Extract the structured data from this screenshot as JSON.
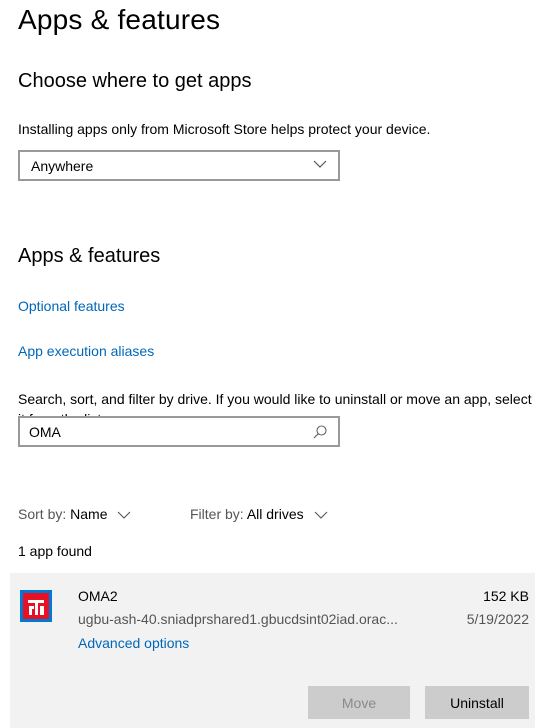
{
  "page": {
    "title": "Apps & features"
  },
  "choose_section": {
    "heading": "Choose where to get apps",
    "description": "Installing apps only from Microsoft Store helps protect your device.",
    "dropdown_value": "Anywhere"
  },
  "apps_section": {
    "heading": "Apps & features",
    "optional_features_link": "Optional features",
    "aliases_link": "App execution aliases",
    "search_description": "Search, sort, and filter by drive. If you would like to uninstall or move an app, select it from the list.",
    "search_value": "OMA",
    "sort_label": "Sort by:",
    "sort_value": "Name",
    "filter_label": "Filter by:",
    "filter_value": "All drives",
    "result_count": "1 app found"
  },
  "app": {
    "name": "OMA2",
    "publisher": "ugbu-ash-40.sniadprshared1.gbucdsint02iad.orac...",
    "size": "152 KB",
    "date": "5/19/2022",
    "advanced_options": "Advanced options",
    "move_label": "Move",
    "uninstall_label": "Uninstall"
  },
  "colors": {
    "link": "#0067b8",
    "app_row_bg": "#f2f2f2",
    "button_bg": "#cccccc",
    "icon_bg": "#e81123"
  },
  "icons": {
    "dropdown": "chevron-down-icon",
    "search": "search-icon",
    "app": "app-icon"
  }
}
